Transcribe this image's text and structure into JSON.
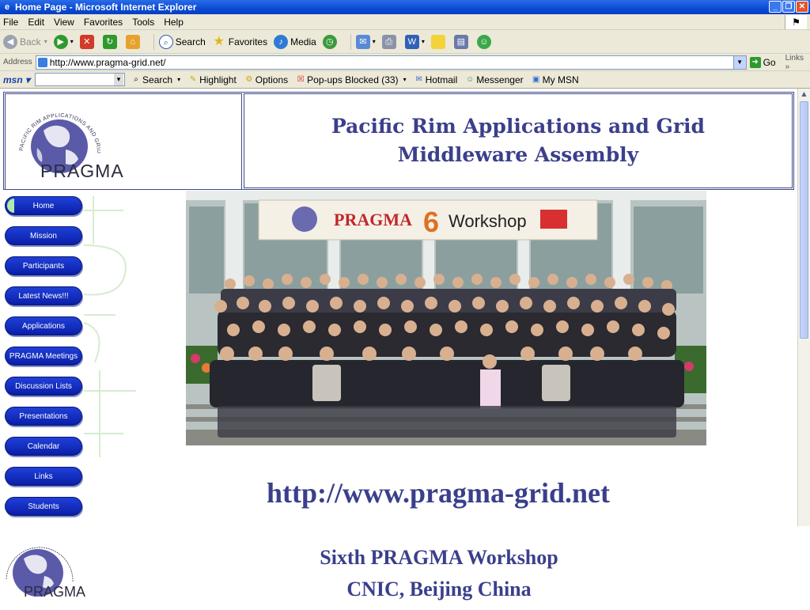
{
  "window": {
    "title": "Home Page - Microsoft Internet Explorer"
  },
  "menubar": {
    "items": [
      "File",
      "Edit",
      "View",
      "Favorites",
      "Tools",
      "Help"
    ]
  },
  "toolbar": {
    "back": "Back",
    "search": "Search",
    "favorites": "Favorites",
    "media": "Media"
  },
  "address": {
    "label": "Address",
    "value": "http://www.pragma-grid.net/",
    "go": "Go",
    "links": "Links"
  },
  "msnbar": {
    "logo": "msn",
    "search": "Search",
    "highlight": "Highlight",
    "options": "Options",
    "popups": "Pop-ups Blocked (33)",
    "hotmail": "Hotmail",
    "messenger": "Messenger",
    "mymsn": "My MSN"
  },
  "page": {
    "logo_text": "PRAGMA",
    "logo_ring_text": "PACIFIC RIM APPLICATIONS AND GRID MIDDLEWARE ASSEMBLY",
    "title_line1": "Pacific Rim Applications and Grid",
    "title_line2": "Middleware Assembly",
    "banner_text": "PRAGMA",
    "banner_num": "6",
    "banner_word": "Workshop",
    "nav": [
      "Home",
      "Mission",
      "Participants",
      "Latest News!!!",
      "Applications",
      "PRAGMA Meetings",
      "Discussion Lists",
      "Presentations",
      "Calendar",
      "Links",
      "Students"
    ]
  },
  "slide": {
    "url": "http://www.pragma-grid.net",
    "line1": "Sixth PRAGMA Workshop",
    "line2": "CNIC, Beijing China",
    "logo_text": "PRAGMA"
  },
  "colors": {
    "title_blue": "#3b3f8c",
    "nav_blue": "#1030c0",
    "ie_title": "#0a4bd4"
  }
}
